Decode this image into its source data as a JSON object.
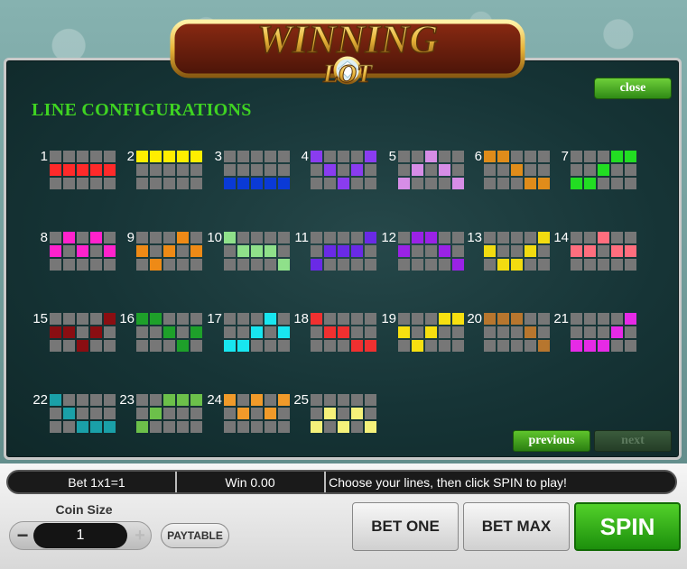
{
  "colors": {
    "title_green": "#3fd322",
    "button_green": "#2f8a15",
    "empty_cell": "#777777"
  },
  "logo": {
    "line1": "WINNING",
    "line2": "LOT"
  },
  "panel": {
    "title": "LINE CONFIGURATIONS",
    "close_label": "close",
    "previous_label": "previous",
    "next_label": "next"
  },
  "lines": [
    {
      "num": "1",
      "color": "#ff2a2a",
      "rows": [
        1,
        1,
        1,
        1,
        1
      ]
    },
    {
      "num": "2",
      "color": "#ffee00",
      "rows": [
        0,
        0,
        0,
        0,
        0
      ]
    },
    {
      "num": "3",
      "color": "#0a3ad6",
      "rows": [
        2,
        2,
        2,
        2,
        2
      ]
    },
    {
      "num": "4",
      "color": "#8a3cf0",
      "rows": [
        0,
        1,
        2,
        1,
        0
      ]
    },
    {
      "num": "5",
      "color": "#d68de6",
      "rows": [
        2,
        1,
        0,
        1,
        2
      ]
    },
    {
      "num": "6",
      "color": "#e08c1a",
      "rows": [
        0,
        0,
        1,
        2,
        2
      ]
    },
    {
      "num": "7",
      "color": "#22dd22",
      "rows": [
        2,
        2,
        1,
        0,
        0
      ]
    },
    {
      "num": "8",
      "color": "#ff22cc",
      "rows": [
        1,
        0,
        1,
        0,
        1
      ]
    },
    {
      "num": "9",
      "color": "#ee8a16",
      "rows": [
        1,
        2,
        1,
        0,
        1
      ]
    },
    {
      "num": "10",
      "color": "#8fe08a",
      "rows": [
        0,
        1,
        1,
        1,
        2
      ]
    },
    {
      "num": "11",
      "color": "#6a2ae6",
      "rows": [
        2,
        1,
        1,
        1,
        0
      ]
    },
    {
      "num": "12",
      "color": "#9a22e6",
      "rows": [
        1,
        0,
        0,
        1,
        2
      ]
    },
    {
      "num": "13",
      "color": "#f2dc10",
      "rows": [
        1,
        2,
        2,
        1,
        0
      ]
    },
    {
      "num": "14",
      "color": "#ff6e7e",
      "rows": [
        1,
        1,
        0,
        1,
        1
      ]
    },
    {
      "num": "15",
      "color": "#8a0e12",
      "rows": [
        1,
        1,
        2,
        1,
        0
      ]
    },
    {
      "num": "16",
      "color": "#1ea02a",
      "rows": [
        0,
        0,
        1,
        2,
        1
      ]
    },
    {
      "num": "17",
      "color": "#18e6f0",
      "rows": [
        2,
        2,
        1,
        0,
        1
      ]
    },
    {
      "num": "18",
      "color": "#f03030",
      "rows": [
        0,
        1,
        1,
        2,
        2
      ]
    },
    {
      "num": "19",
      "color": "#f7e010",
      "rows": [
        1,
        2,
        1,
        0,
        0
      ]
    },
    {
      "num": "20",
      "color": "#b7762e",
      "rows": [
        0,
        0,
        0,
        1,
        2
      ]
    },
    {
      "num": "21",
      "color": "#e62ae6",
      "rows": [
        2,
        2,
        2,
        1,
        0
      ]
    },
    {
      "num": "22",
      "color": "#1aa0a8",
      "rows": [
        0,
        1,
        2,
        2,
        2
      ]
    },
    {
      "num": "23",
      "color": "#6cc04a",
      "rows": [
        2,
        1,
        0,
        0,
        0
      ]
    },
    {
      "num": "24",
      "color": "#f09a2a",
      "rows": [
        0,
        1,
        0,
        1,
        0
      ]
    },
    {
      "num": "25",
      "color": "#f5f17a",
      "rows": [
        2,
        1,
        2,
        1,
        2
      ]
    }
  ],
  "status": {
    "bet": "Bet 1x1=1",
    "win": "Win 0.00",
    "message": "Choose your lines, then click SPIN to play!"
  },
  "controls": {
    "coin_size_label": "Coin Size",
    "coin_value": "1",
    "minus": "−",
    "plus": "+",
    "paytable": "PAYTABLE",
    "bet_one": "BET ONE",
    "bet_max": "BET MAX",
    "spin": "SPIN"
  }
}
